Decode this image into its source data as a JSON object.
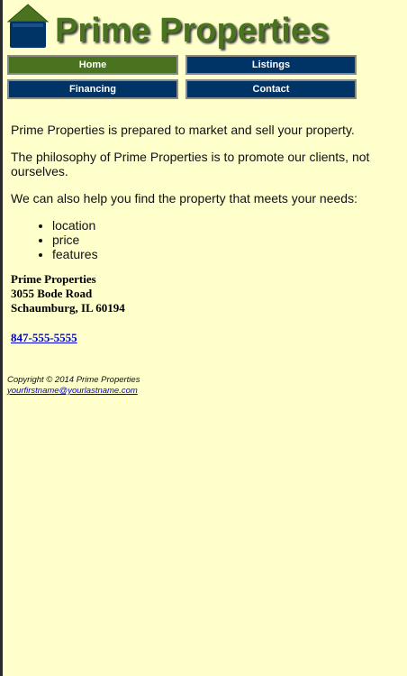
{
  "header": {
    "title": "Prime Properties"
  },
  "nav": {
    "items": [
      {
        "label": "Home"
      },
      {
        "label": "Listings"
      },
      {
        "label": "Financing"
      },
      {
        "label": "Contact"
      }
    ]
  },
  "main": {
    "intro": "Prime Properties is prepared to market and sell your property.",
    "philosophy": "The philosophy of Prime Properties is to promote our clients, not ourselves.",
    "help": "We can also help you find the property that meets your needs:",
    "features": [
      "location",
      "price",
      "features"
    ],
    "address": {
      "name": "Prime Properties",
      "street": "3055 Bode Road",
      "city": "Schaumburg, IL 60194"
    },
    "phone": "847-555-5555"
  },
  "footer": {
    "copyright": "Copyright © 2014 Prime Properties",
    "email": "yourfirstname@yourlastname.com"
  },
  "colors": {
    "background": "#ffffcc",
    "brand_green": "#4a7320",
    "nav_blue": "#003366",
    "link_blue": "#0000cc"
  }
}
